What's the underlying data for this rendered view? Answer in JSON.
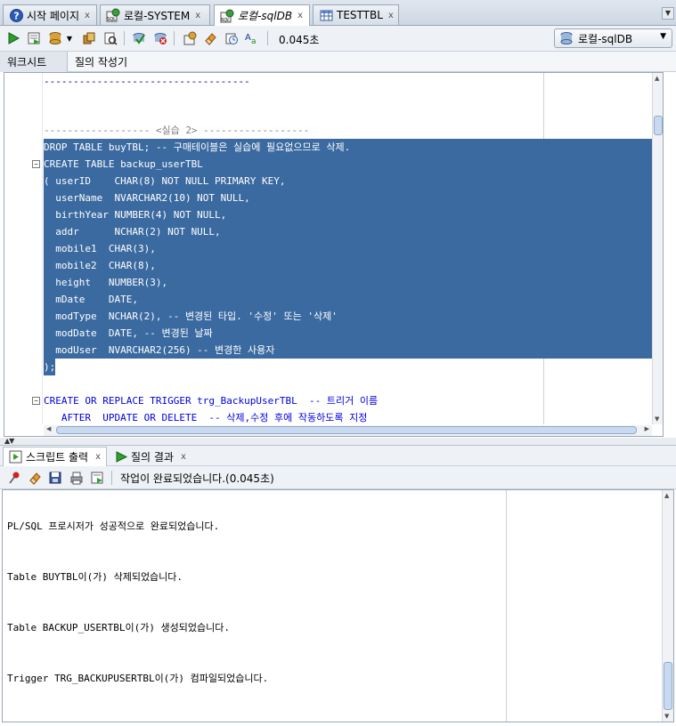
{
  "tabs": [
    {
      "label": "시작 페이지",
      "icon": "help-icon"
    },
    {
      "label": "로컬-SYSTEM",
      "icon": "sql-worksheet-icon"
    },
    {
      "label": "로컬-sqlDB",
      "icon": "sql-worksheet-icon",
      "active": true
    },
    {
      "label": "TESTTBL",
      "icon": "table-icon"
    }
  ],
  "toolbar": {
    "elapsed": "0.045초",
    "connection": "로컬-sqlDB"
  },
  "subtabs": [
    "워크시트",
    "질의 작성기"
  ],
  "editor": {
    "lines": [
      "-----------------------------------",
      "",
      "",
      "------------------ <실습 2> ------------------",
      "DROP TABLE buyTBL; -- 구매테이블은 실습에 필요없으므로 삭제.",
      "CREATE TABLE backup_userTBL",
      "( userID    CHAR(8) NOT NULL PRIMARY KEY,",
      "  userName  NVARCHAR2(10) NOT NULL,",
      "  birthYear NUMBER(4) NOT NULL,",
      "  addr      NCHAR(2) NOT NULL,",
      "  mobile1  CHAR(3),",
      "  mobile2  CHAR(8),",
      "  height   NUMBER(3),",
      "  mDate    DATE,",
      "  modType  NCHAR(2), -- 변경된 타입. '수정' 또는 '삭제'",
      "  modDate  DATE, -- 변경된 날짜",
      "  modUser  NVARCHAR2(256) -- 변경한 사용자",
      ");",
      "",
      "CREATE OR REPLACE TRIGGER trg_BackupUserTBL  -- 트리거 이름",
      "   AFTER  UPDATE OR DELETE  -- 삭제,수정 후에 작동하도록 지정"
    ]
  },
  "output_tabs": [
    {
      "label": "스크립트 출력",
      "active": true
    },
    {
      "label": "질의 결과",
      "active": false
    }
  ],
  "output_status": "작업이 완료되었습니다.(0.045초)",
  "output_lines": [
    "PL/SQL 프로시저가 성공적으로 완료되었습니다.",
    "Table BUYTBL이(가) 삭제되었습니다.",
    "Table BACKUP_USERTBL이(가) 생성되었습니다.",
    "Trigger TRG_BACKUPUSERTBL이(가) 컴파일되었습니다."
  ],
  "colors": {
    "selection": "#3b6aa0",
    "keyword": "#0000e0",
    "chrome": "#eef2f7"
  }
}
